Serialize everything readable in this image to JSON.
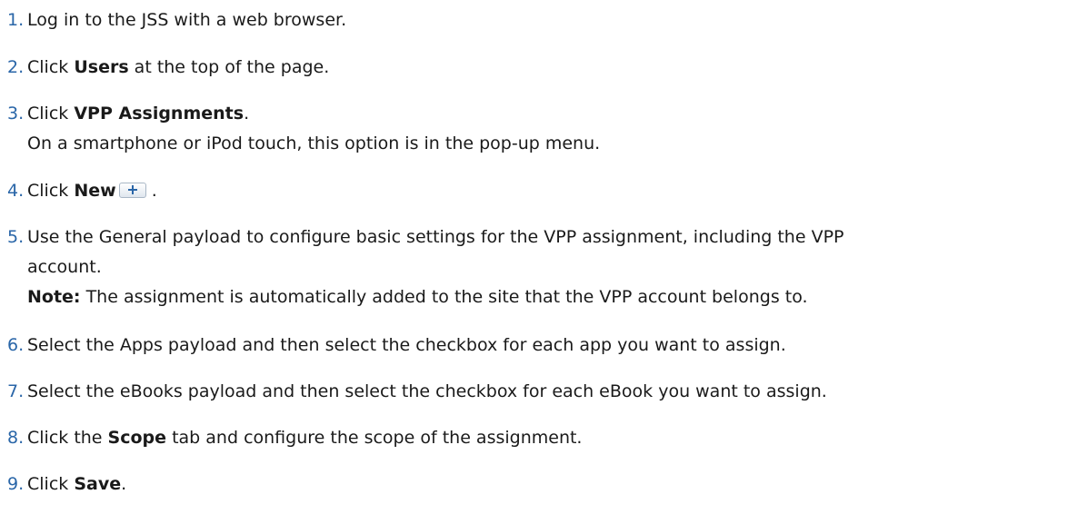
{
  "steps": [
    {
      "num": "1.",
      "pre": "Log in to the JSS with a web browser."
    },
    {
      "num": "2.",
      "pre": "Click ",
      "bold": "Users",
      "post": " at the top of the page."
    },
    {
      "num": "3.",
      "pre": "Click ",
      "bold": "VPP Assignments",
      "post": ".",
      "line2": "On a smartphone or iPod touch, this option is in the pop-up menu."
    },
    {
      "num": "4.",
      "pre": "Click ",
      "bold": "New",
      "post": " .",
      "icon": "plus-icon"
    },
    {
      "num": "5.",
      "pre": "Use the General payload to configure basic settings for the VPP assignment, including the VPP",
      "line2": "account.",
      "note_label": "Note:",
      "note_text": " The assignment is automatically added to the site that the VPP account belongs to."
    },
    {
      "num": "6.",
      "pre": "Select the Apps payload and then select the checkbox for each app you want to assign."
    },
    {
      "num": "7.",
      "pre": "Select the eBooks payload and then select the checkbox for each eBook you want to assign."
    },
    {
      "num": "8.",
      "pre": "Click the ",
      "bold": "Scope",
      "post": " tab and configure the scope of the assignment."
    },
    {
      "num": "9.",
      "pre": "Click ",
      "bold": "Save",
      "post": "."
    }
  ],
  "colors": {
    "number": "#2a66a8",
    "text": "#1a1a1a"
  }
}
